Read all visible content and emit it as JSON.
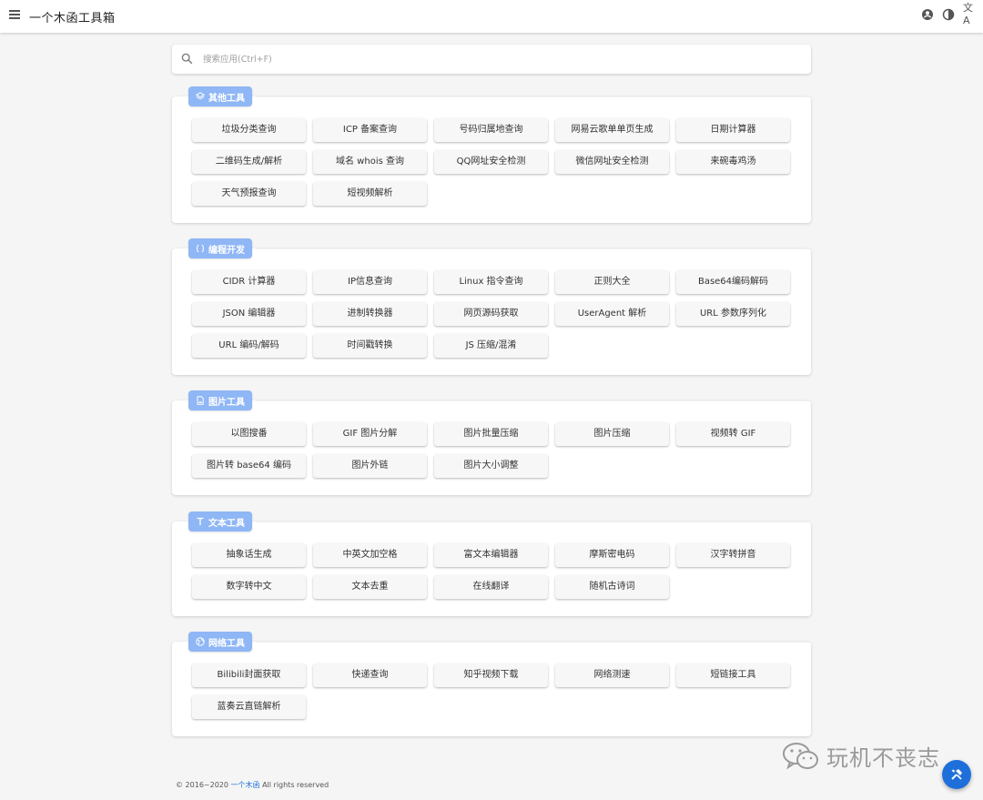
{
  "header": {
    "title": "一个木函工具箱",
    "icons": [
      "menu-icon",
      "account-icon",
      "theme-icon",
      "translate-icon"
    ],
    "translate_glyph": "文A"
  },
  "search": {
    "placeholder": "搜索应用(Ctrl+F)"
  },
  "categories": [
    {
      "name": "其他工具",
      "icon": "layers-icon",
      "items": [
        "垃圾分类查询",
        "ICP 备案查询",
        "号码归属地查询",
        "网易云歌单单页生成",
        "日期计算器",
        "二维码生成/解析",
        "域名 whois 查询",
        "QQ网址安全检测",
        "微信网址安全检测",
        "来碗毒鸡汤",
        "天气预报查询",
        "短视频解析"
      ]
    },
    {
      "name": "编程开发",
      "icon": "code-icon",
      "items": [
        "CIDR 计算器",
        "IP信息查询",
        "Linux 指令查询",
        "正则大全",
        "Base64编码解码",
        "JSON 编辑器",
        "进制转换器",
        "网页源码获取",
        "UserAgent 解析",
        "URL 参数序列化",
        "URL 编码/解码",
        "时间戳转换",
        "JS 压缩/混淆"
      ]
    },
    {
      "name": "图片工具",
      "icon": "image-icon",
      "items": [
        "以图搜番",
        "GIF 图片分解",
        "图片批量压缩",
        "图片压缩",
        "视频转 GIF",
        "图片转 base64 编码",
        "图片外链",
        "图片大小调整"
      ]
    },
    {
      "name": "文本工具",
      "icon": "text-icon",
      "items": [
        "抽象话生成",
        "中英文加空格",
        "富文本编辑器",
        "摩斯密电码",
        "汉字转拼音",
        "数字转中文",
        "文本去重",
        "在线翻译",
        "随机古诗词"
      ]
    },
    {
      "name": "网络工具",
      "icon": "globe-icon",
      "items": [
        "Bilibili封面获取",
        "快递查询",
        "知乎视频下载",
        "网络测速",
        "短链接工具",
        "蓝奏云直链解析"
      ]
    }
  ],
  "footer": {
    "prefix": "© 2016~2020",
    "link": "一个木函",
    "suffix": "All rights reserved"
  },
  "watermark": {
    "text": "玩机不丧志"
  },
  "colors": {
    "accent": "#1e6fd9",
    "chip": "#8fb6f5",
    "background": "#f5f5f5"
  }
}
